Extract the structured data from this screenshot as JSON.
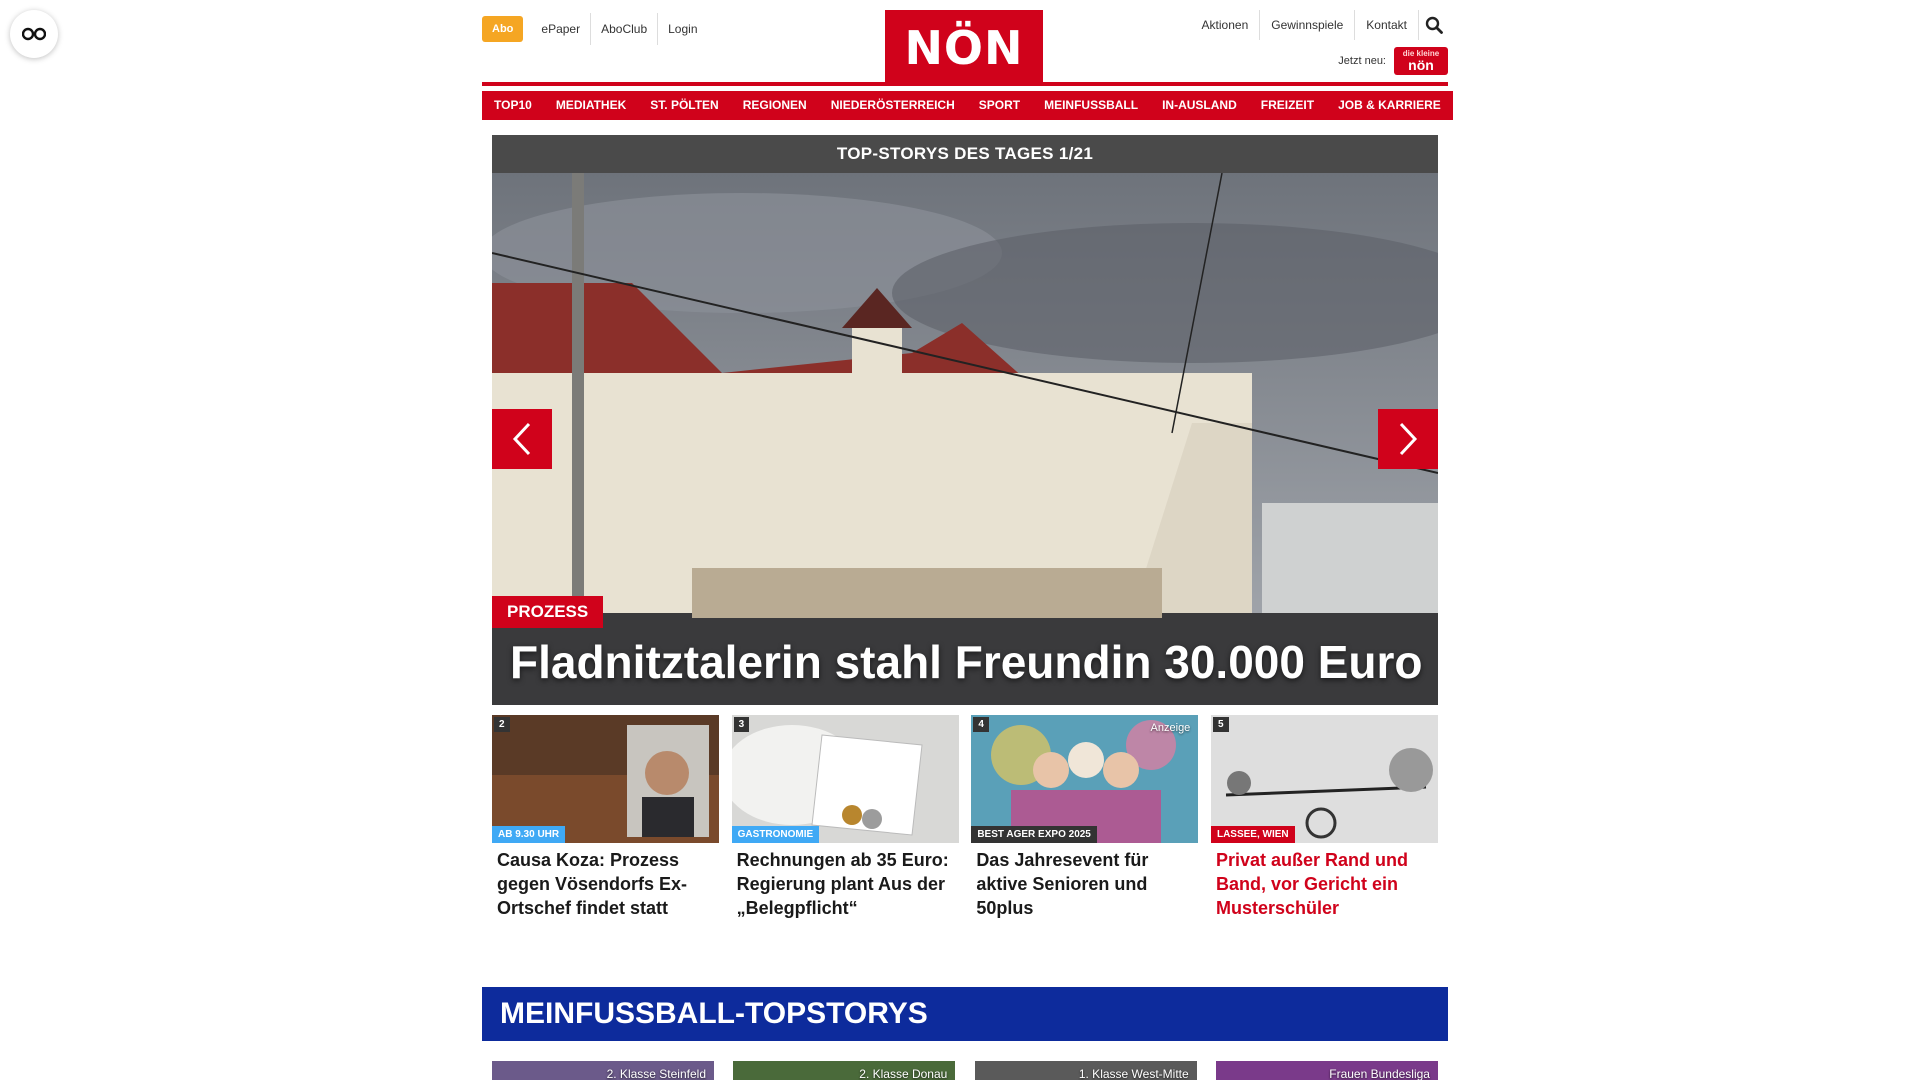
{
  "header": {
    "abo_label": "Abo",
    "left_links": [
      "ePaper",
      "AboClub",
      "Login"
    ],
    "logo_text": "NÖN",
    "right_links": [
      "Aktionen",
      "Gewinnspiele",
      "Kontakt"
    ],
    "jetzt_label": "Jetzt neu:",
    "mini_logo_top": "die kleine",
    "mini_logo_text": "nön"
  },
  "nav": [
    "TOP10",
    "MEDIATHEK",
    "ST. PÖLTEN",
    "REGIONEN",
    "NIEDERÖSTERREICH",
    "SPORT",
    "MEINFUSSBALL",
    "IN-AUSLAND",
    "FREIZEIT",
    "JOB & KARRIERE"
  ],
  "hero": {
    "bar_title": "TOP-STORYS DES TAGES 1/21",
    "badge": "PROZESS",
    "title": "Fladnitztalerin stahl Freundin 30.000 Euro"
  },
  "teasers": [
    {
      "num": "2",
      "tag": "AB 9.30 UHR",
      "tag_color": "#3fa9f5",
      "title": "Causa Koza: Prozess gegen Vösendorfs Ex-Ortschef findet statt",
      "red": false
    },
    {
      "num": "3",
      "tag": "GASTRONOMIE",
      "tag_color": "#3fa9f5",
      "title": "Rechnungen ab 35 Euro: Regierung plant Aus der „Belegpflicht“",
      "red": false
    },
    {
      "num": "4",
      "tag": "BEST AGER EXPO 2025",
      "tag_color": "#333333",
      "anzeige": "Anzeige",
      "title": "Das Jahresevent für aktive Senioren und 50plus",
      "red": false
    },
    {
      "num": "5",
      "tag": "LASSEE, WIEN",
      "tag_color": "#d0021b",
      "title": "Privat außer Rand und Band, vor Gericht ein Musterschüler",
      "red": true
    }
  ],
  "fussball": {
    "title": "MEINFUSSBALL-TOPSTORYS",
    "cards": [
      "2. Klasse Steinfeld",
      "2. Klasse Donau",
      "1. Klasse West-Mitte",
      "Frauen Bundesliga"
    ]
  },
  "colors": {
    "brand_red": "#d0021b",
    "abo_orange": "#f5a623",
    "fussball_blue": "#0d2b9c"
  }
}
